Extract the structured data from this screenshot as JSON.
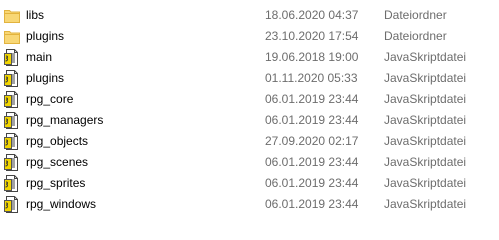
{
  "colors": {
    "folder": "#f8d775",
    "folder_dark": "#e2b33e",
    "script_yellow": "#f2d600",
    "secondary_text": "#6d6d6d"
  },
  "files": [
    {
      "name": "libs",
      "date": "18.06.2020 04:37",
      "type": "Dateiordner",
      "icon": "folder-icon"
    },
    {
      "name": "plugins",
      "date": "23.10.2020 17:54",
      "type": "Dateiordner",
      "icon": "folder-icon"
    },
    {
      "name": "main",
      "date": "19.06.2018 19:00",
      "type": "JavaSkriptdatei",
      "icon": "script-file-icon"
    },
    {
      "name": "plugins",
      "date": "01.11.2020 05:33",
      "type": "JavaSkriptdatei",
      "icon": "script-file-icon"
    },
    {
      "name": "rpg_core",
      "date": "06.01.2019 23:44",
      "type": "JavaSkriptdatei",
      "icon": "script-file-icon"
    },
    {
      "name": "rpg_managers",
      "date": "06.01.2019 23:44",
      "type": "JavaSkriptdatei",
      "icon": "script-file-icon"
    },
    {
      "name": "rpg_objects",
      "date": "27.09.2020 02:17",
      "type": "JavaSkriptdatei",
      "icon": "script-file-icon"
    },
    {
      "name": "rpg_scenes",
      "date": "06.01.2019 23:44",
      "type": "JavaSkriptdatei",
      "icon": "script-file-icon"
    },
    {
      "name": "rpg_sprites",
      "date": "06.01.2019 23:44",
      "type": "JavaSkriptdatei",
      "icon": "script-file-icon"
    },
    {
      "name": "rpg_windows",
      "date": "06.01.2019 23:44",
      "type": "JavaSkriptdatei",
      "icon": "script-file-icon"
    }
  ]
}
